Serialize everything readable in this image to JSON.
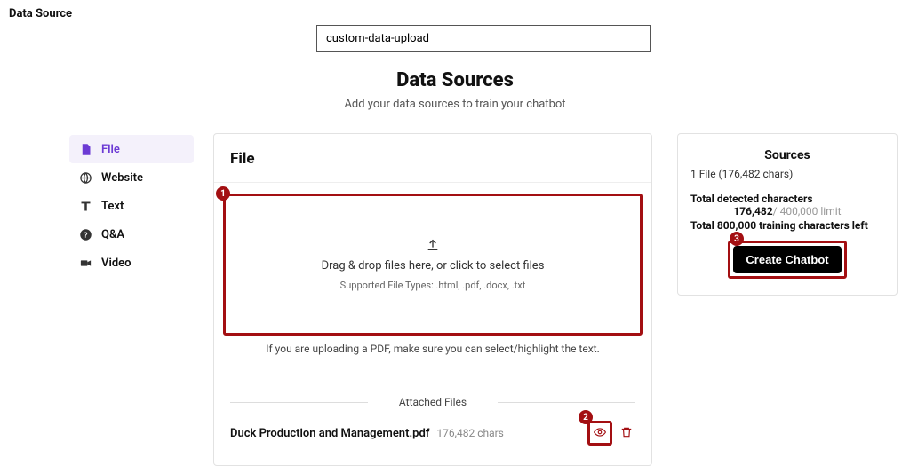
{
  "page_label": "Data Source",
  "name_input_value": "custom-data-upload",
  "heading": "Data Sources",
  "subheading": "Add your data sources to train your chatbot",
  "sidebar": {
    "items": [
      {
        "label": "File",
        "icon": "document-icon",
        "active": true
      },
      {
        "label": "Website",
        "icon": "globe-icon",
        "active": false
      },
      {
        "label": "Text",
        "icon": "text-icon",
        "active": false
      },
      {
        "label": "Q&A",
        "icon": "question-icon",
        "active": false
      },
      {
        "label": "Video",
        "icon": "video-icon",
        "active": false
      }
    ]
  },
  "main": {
    "title": "File",
    "upload_primary": "Drag & drop files here, or click to select files",
    "upload_secondary": "Supported File Types: .html, .pdf, .docx, .txt",
    "pdf_note": "If you are uploading a PDF, make sure you can select/highlight the text.",
    "attached_heading": "Attached Files",
    "files": [
      {
        "name": "Duck Production and Management.pdf",
        "chars_label": "176,482 chars"
      }
    ]
  },
  "right": {
    "title": "Sources",
    "file_summary": "1 File (176,482 chars)",
    "tdc_label": "Total detected characters",
    "tdc_count": "176,482",
    "tdc_limit": "/ 400,000 limit",
    "training_left": "Total 800,000 training characters left",
    "create_label": "Create Chatbot"
  },
  "annotations": {
    "1": "1",
    "2": "2",
    "3": "3"
  }
}
